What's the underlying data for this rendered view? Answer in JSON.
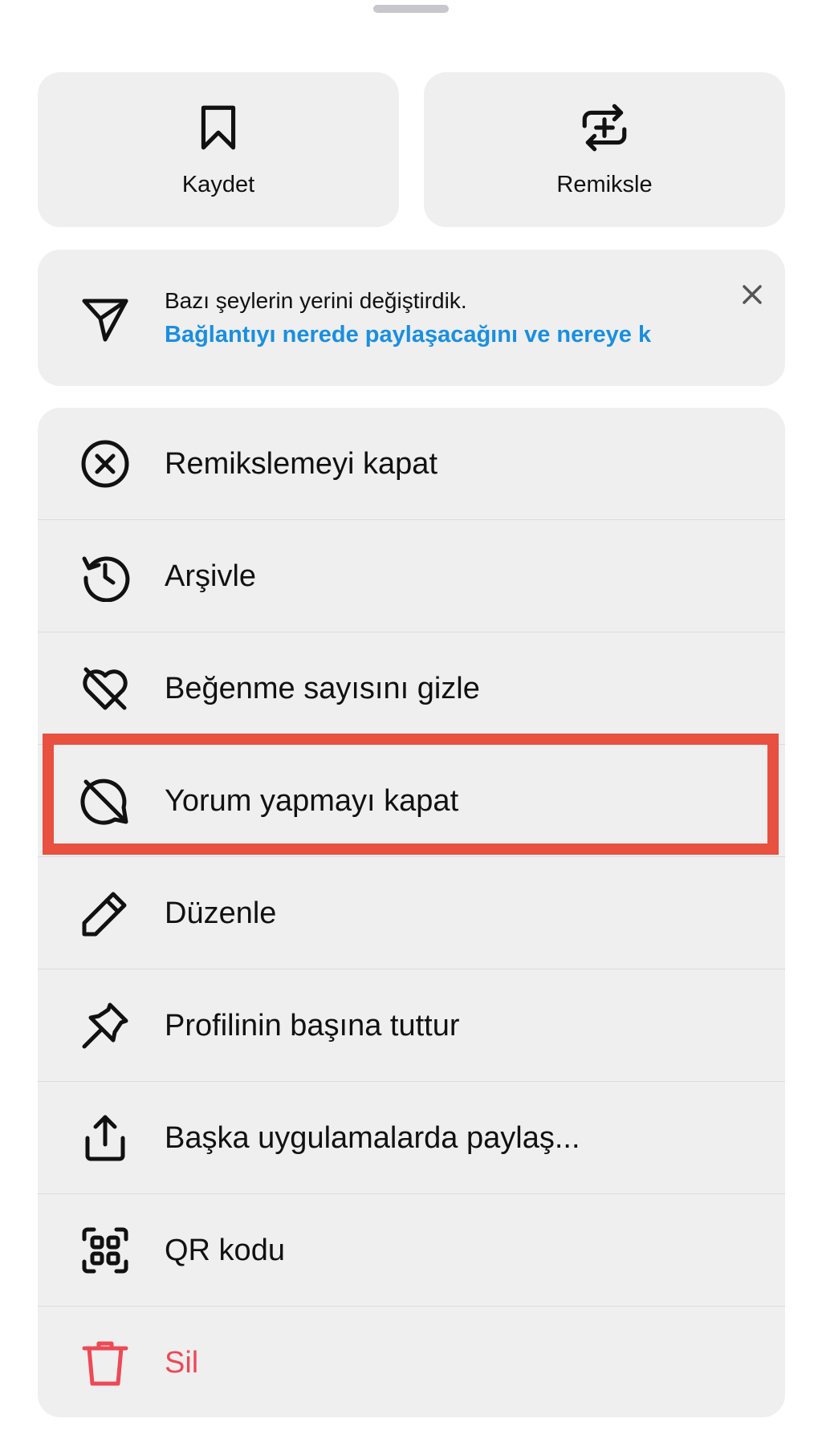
{
  "top_actions": {
    "save_label": "Kaydet",
    "remix_label": "Remiksle"
  },
  "notice": {
    "title": "Bazı şeylerin yerini değiştirdik.",
    "link": "Bağlantıyı nerede paylaşacağını ve nereye k"
  },
  "menu": {
    "items": [
      {
        "label": "Remikslemeyi kapat",
        "icon": "close-circle-icon"
      },
      {
        "label": "Arşivle",
        "icon": "archive-history-icon"
      },
      {
        "label": "Beğenme sayısını gizle",
        "icon": "heart-off-icon"
      },
      {
        "label": "Yorum yapmayı kapat",
        "icon": "comment-off-icon"
      },
      {
        "label": "Düzenle",
        "icon": "pencil-icon"
      },
      {
        "label": "Profilinin başına tuttur",
        "icon": "pin-icon"
      },
      {
        "label": "Başka uygulamalarda paylaş...",
        "icon": "share-icon"
      },
      {
        "label": "QR kodu",
        "icon": "qr-code-icon"
      },
      {
        "label": "Sil",
        "icon": "trash-icon"
      }
    ]
  },
  "colors": {
    "card_background": "#efefef",
    "link_blue": "#1a8fe0",
    "danger_red": "#ed4956",
    "highlight_red": "#e8503f"
  }
}
